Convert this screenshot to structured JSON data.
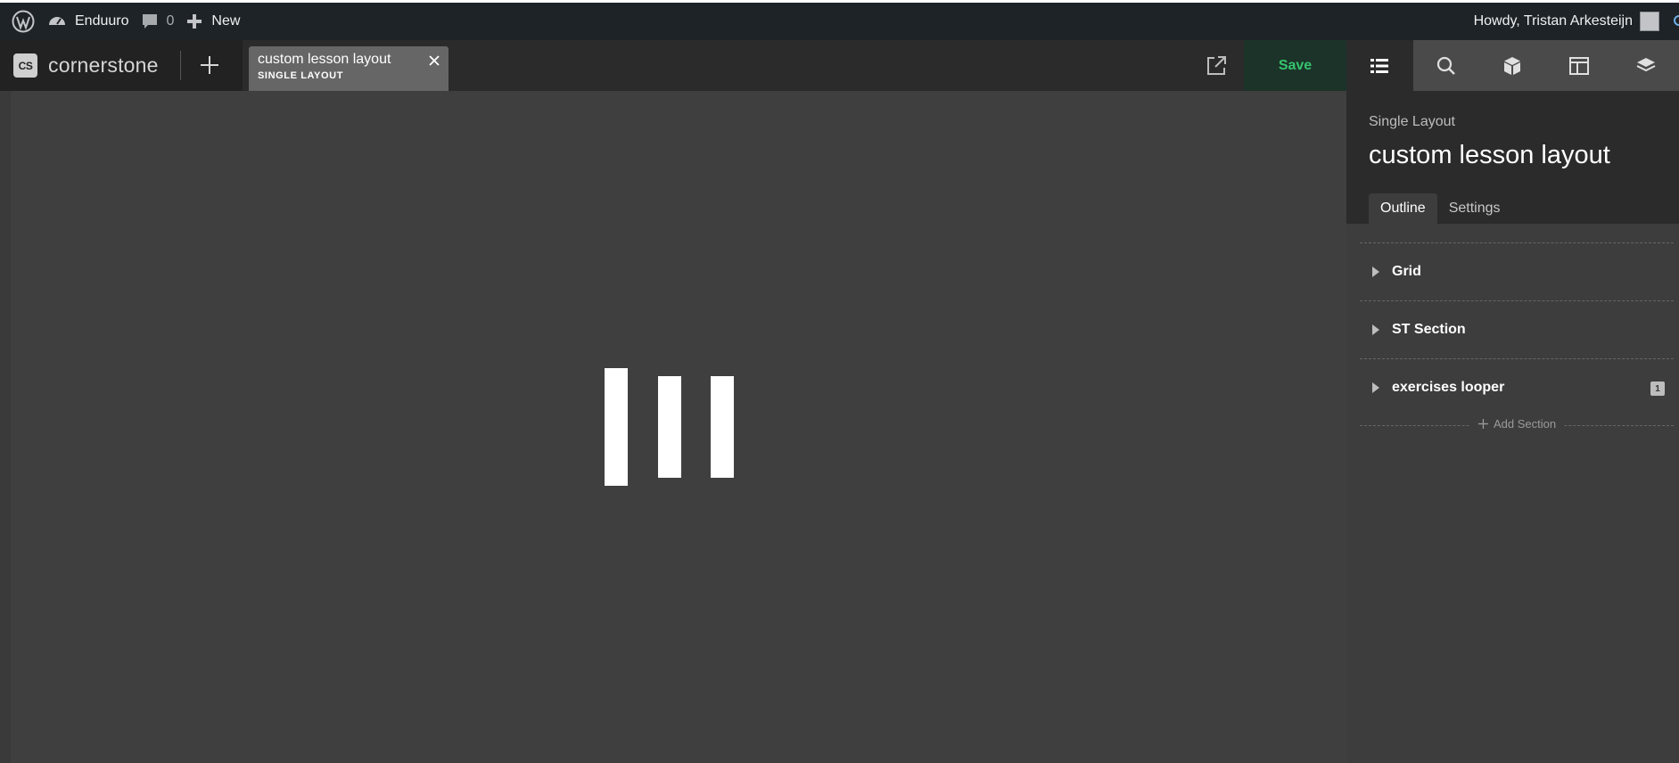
{
  "adminbar": {
    "site_name": "Enduuro",
    "comments_count": "0",
    "new_label": "New",
    "howdy": "Howdy, Tristan Arkesteijn"
  },
  "toolbar": {
    "brand": "cornerstone",
    "brand_logo": "CS",
    "doc_tab": {
      "title": "custom lesson layout",
      "type": "SINGLE LAYOUT"
    },
    "save_label": "Save"
  },
  "panel": {
    "tabs": [
      "outline-icon",
      "search-icon",
      "elements-icon",
      "layout-icon",
      "layers-icon"
    ],
    "subtitle": "Single Layout",
    "title": "custom lesson layout",
    "inner_tabs": [
      "Outline",
      "Settings"
    ],
    "items": [
      {
        "label": "Grid",
        "badge": ""
      },
      {
        "label": "ST Section",
        "badge": ""
      },
      {
        "label": "exercises looper",
        "badge": "1"
      }
    ],
    "add_section": "Add Section"
  },
  "colors": {
    "admin_bar": "#1d2327",
    "toolbar": "#2b2b2b",
    "canvas": "#3f3f3f",
    "save_text": "#35c46d",
    "panel_body": "#3d3d3d"
  }
}
